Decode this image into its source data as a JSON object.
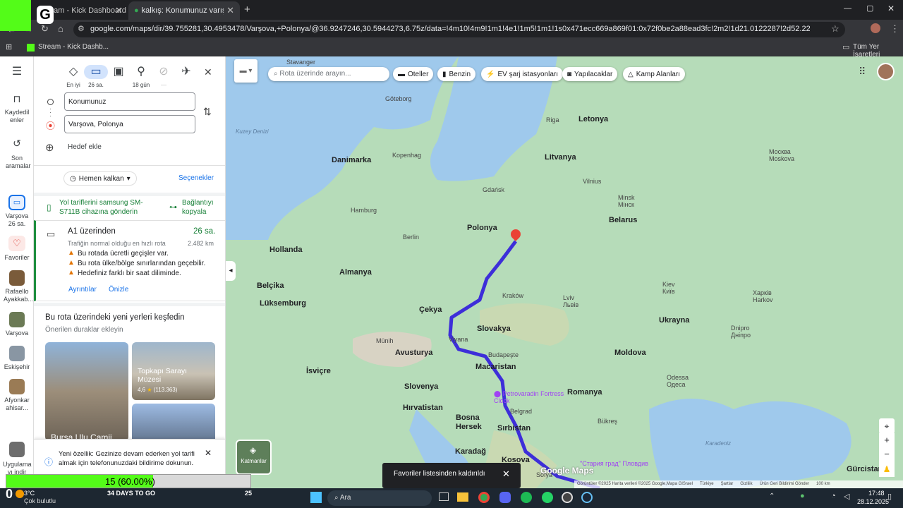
{
  "browser": {
    "tabs": [
      {
        "label": "Stream - Kick Dashboard",
        "active": false
      },
      {
        "label": "kalkış: Konumunuz varış: Varşova",
        "active": true
      }
    ],
    "new_tab": "+",
    "url": "google.com/maps/dir/39.755281,30.4953478/Varşova,+Polonya/@36.9247246,30.5944273,6.75z/data=!4m10!4m9!1m1!4e1!1m5!1m1!1s0x471ecc669a869f01:0x72f0be2a88ead3fc!2m2!1d21.0122287!2d52.2296756!3e0?entry=ttu&g_ep=EgoyMDI1...",
    "bookmark": "Stream - Kick Dashb...",
    "all_bookmarks": "Tüm Yer İşaretleri",
    "window_controls": [
      "—",
      "▢",
      "✕"
    ]
  },
  "rail": {
    "saved": "Kaydedilenler",
    "recent": "Son aramalar",
    "items": [
      {
        "label": "Varşova 26 sa.",
        "icon": "car-icon"
      },
      {
        "label": "Favoriler",
        "icon": "heart-icon"
      },
      {
        "label": "Rafaello Ayakkab...",
        "icon": "thumb"
      },
      {
        "label": "Varşova",
        "icon": "thumb"
      },
      {
        "label": "Eskişehir",
        "icon": "thumb"
      },
      {
        "label": "Afyonkar ahisar...",
        "icon": "thumb"
      },
      {
        "label": "Uygulama yı indir",
        "icon": "thumb"
      }
    ],
    "menu_icon": "menu-icon"
  },
  "directions": {
    "modes": [
      {
        "label": "En iyi",
        "icon": "◇"
      },
      {
        "label": "26 sa.",
        "icon": "car"
      },
      {
        "label": "",
        "icon": "bus"
      },
      {
        "label": "18 gün",
        "icon": "walk"
      },
      {
        "label": "—",
        "icon": "bike"
      },
      {
        "label": "",
        "icon": "plane"
      }
    ],
    "origin": "Konumunuz",
    "destination": "Varşova, Polonya",
    "add_destination": "Hedef ekle",
    "depart": "Hemen kalkan",
    "options": "Seçenekler",
    "send_to_device": "Yol tariflerini samsung SM-S711B cihazına gönderin",
    "copy_link": "Bağlantıyı kopyala"
  },
  "route": {
    "via": "A1 üzerinden",
    "duration": "26 sa.",
    "subtitle": "Trafiğin normal olduğu en hızlı rota",
    "distance": "2.482 km",
    "warnings": [
      "Bu rotada ücretli geçişler var.",
      "Bu rota ülke/bölge sınırlarından geçebilir.",
      "Hedefiniz farklı bir saat diliminde."
    ],
    "details": "Ayrıntılar",
    "preview": "Önizle"
  },
  "explore": {
    "title": "Bu rota üzerindeki yeni yerleri keşfedin",
    "subtitle": "Önerilen duraklar ekleyin",
    "cards": [
      {
        "name": "Topkapı Sarayı Müzesi",
        "rating": "4,6",
        "reviews": "(113.363)"
      },
      {
        "name": "Bursa Ulu Camii"
      }
    ]
  },
  "notice": {
    "text": "Yeni özellik: Gezinize devam ederken yol tarifi almak için telefonunuzdaki bildirime dokunun."
  },
  "map": {
    "search_placeholder": "Rota üzerinde arayın...",
    "chips": [
      "Oteller",
      "Benzin",
      "EV şarj istasyonları",
      "Yapılacaklar",
      "Kamp Alanları"
    ],
    "layers": "Katmanlar",
    "countries": [
      "Letonya",
      "Litvanya",
      "Danimarka",
      "Polonya",
      "Belarus",
      "Almanya",
      "Hollanda",
      "Belçika",
      "Lüksemburg",
      "Çekya",
      "Slovakya",
      "Ukrayna",
      "Avusturya",
      "İsviçre",
      "Macaristan",
      "Moldova",
      "Slovenya",
      "Hırvatistan",
      "Romanya",
      "Bosna Hersek",
      "Sırbistan",
      "Karadağ",
      "Kosova",
      "Gürcistan"
    ],
    "cities": [
      "Stavanger",
      "Göteborg",
      "Riga",
      "Kopenhag",
      "Gdańsk",
      "Vilnius",
      "Москва Moskova",
      "Hamburg",
      "Berlin",
      "Minsk Мінск",
      "Kiev Київ",
      "Kraków",
      "Lviv Львів",
      "Харків Harkov",
      "Münih",
      "Viyana",
      "Budapeşte",
      "Dnipro Дніпро",
      "Odessa Одеса",
      "Belgrad",
      "Bükreş",
      "Sofya"
    ],
    "water": [
      "Kuzey Denizi",
      "Karadeniz"
    ],
    "poi": "Petrovaradin Fortress Clock",
    "poi2": "\"Стария град\" Пловдив",
    "toast": "Favoriler listesinden kaldırıldı",
    "footer": [
      "Görüntüler ©2025 Harita verileri ©2025 Google,Mapa GISrael",
      "Türkiye",
      "Şartlar",
      "Gizlilik",
      "Ürün Geri Bildirimi Gönder",
      "100 km"
    ],
    "brand": "Google Maps"
  },
  "overlay": {
    "progress": "15 (60.00%)",
    "progress_value": 0.6,
    "count": "0",
    "days": "34 DAYS TO GO",
    "num": "25"
  },
  "taskbar": {
    "temp": "3°C",
    "weather": "Çok bulutlu",
    "search": "Ara",
    "time": "17:48",
    "date": "28.12.2025"
  }
}
